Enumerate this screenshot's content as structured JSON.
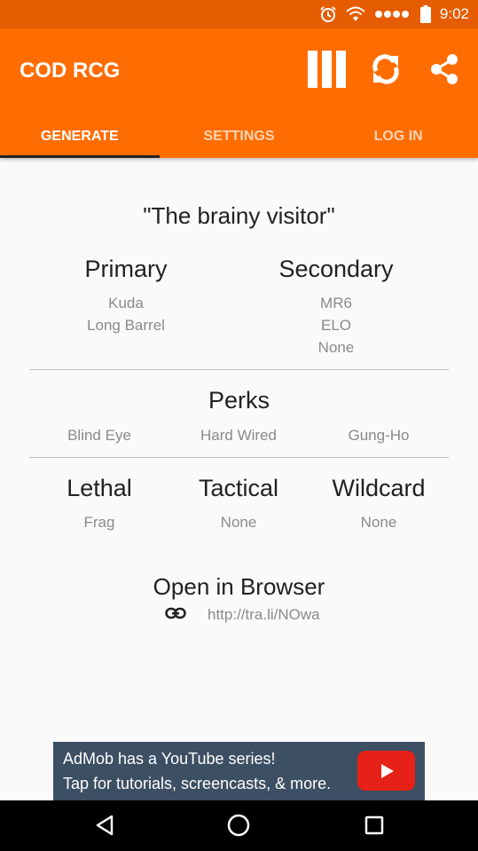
{
  "status_bar": {
    "time": "9:02",
    "icons": [
      "alarm-icon",
      "wifi-icon",
      "signal-icon",
      "battery-icon"
    ]
  },
  "app_bar": {
    "title": "COD RCG",
    "actions": [
      "columns-icon",
      "refresh-icon",
      "share-icon"
    ]
  },
  "tabs": [
    {
      "label": "GENERATE",
      "active": true
    },
    {
      "label": "SETTINGS",
      "active": false
    },
    {
      "label": "LOG IN",
      "active": false
    }
  ],
  "class": {
    "name": "\"The brainy visitor\"",
    "primary": {
      "title": "Primary",
      "items": [
        "Kuda",
        "Long Barrel"
      ]
    },
    "secondary": {
      "title": "Secondary",
      "items": [
        "MR6",
        "ELO",
        "None"
      ]
    },
    "perks": {
      "title": "Perks",
      "items": [
        "Blind Eye",
        "Hard Wired",
        "Gung-Ho"
      ]
    },
    "lethal": {
      "title": "Lethal",
      "value": "Frag"
    },
    "tactical": {
      "title": "Tactical",
      "value": "None"
    },
    "wildcard": {
      "title": "Wildcard",
      "value": "None"
    }
  },
  "browser": {
    "title": "Open in Browser",
    "url": "http://tra.li/NOwa"
  },
  "ad": {
    "line1": "AdMob has a YouTube series!",
    "line2": "Tap for tutorials, screencasts, & more."
  },
  "colors": {
    "status_bar": "#e65c00",
    "app_bar": "#ff6d00",
    "indicator": "#222222",
    "ad_bg": "#3d4f63",
    "youtube_red": "#e62117"
  }
}
